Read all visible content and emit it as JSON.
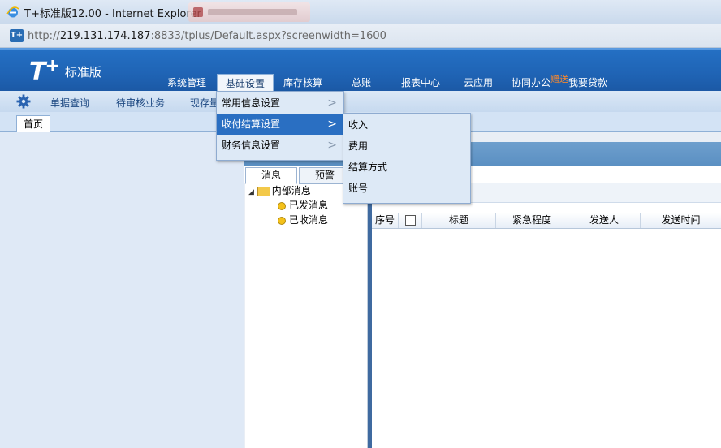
{
  "browser": {
    "window_title": "T+标准版12.00 - Internet Explorer",
    "address_prefix": "http://",
    "address_host": "219.131.174.187",
    "address_rest": ":8833/tplus/Default.aspx?screenwidth=1600",
    "favicon_text": "T+"
  },
  "app": {
    "logo_main": "T",
    "logo_plus": "+",
    "logo_edition": "标准版",
    "accent_color": "#1f63b4"
  },
  "nav": {
    "items": [
      {
        "label": "系统管理"
      },
      {
        "label": "基础设置"
      },
      {
        "label": "库存核算"
      },
      {
        "label": "总账"
      },
      {
        "label": "报表中心"
      },
      {
        "label": "云应用"
      },
      {
        "label": "协同办公"
      }
    ],
    "promo_badge": "赠送",
    "promo_label": "我要贷款"
  },
  "subbar": {
    "items": [
      {
        "label": "单据查询"
      },
      {
        "label": "待审核业务"
      },
      {
        "label": "现存量"
      }
    ]
  },
  "tabs": {
    "home": "首页"
  },
  "menu_basic": {
    "items": [
      {
        "label": "常用信息设置"
      },
      {
        "label": "收付结算设置"
      },
      {
        "label": "财务信息设置"
      }
    ]
  },
  "menu_settlement": {
    "items": [
      {
        "label": "收入"
      },
      {
        "label": "费用"
      },
      {
        "label": "结算方式"
      },
      {
        "label": "账号"
      }
    ]
  },
  "message_panel": {
    "tab_messages": "消息",
    "tab_alerts": "预警",
    "tree_root": "内部消息",
    "tree_sent": "已发消息",
    "tree_received": "已收消息"
  },
  "grid": {
    "columns": [
      "序号",
      "",
      "标题",
      "紧急程度",
      "发送人",
      "发送时间"
    ]
  }
}
